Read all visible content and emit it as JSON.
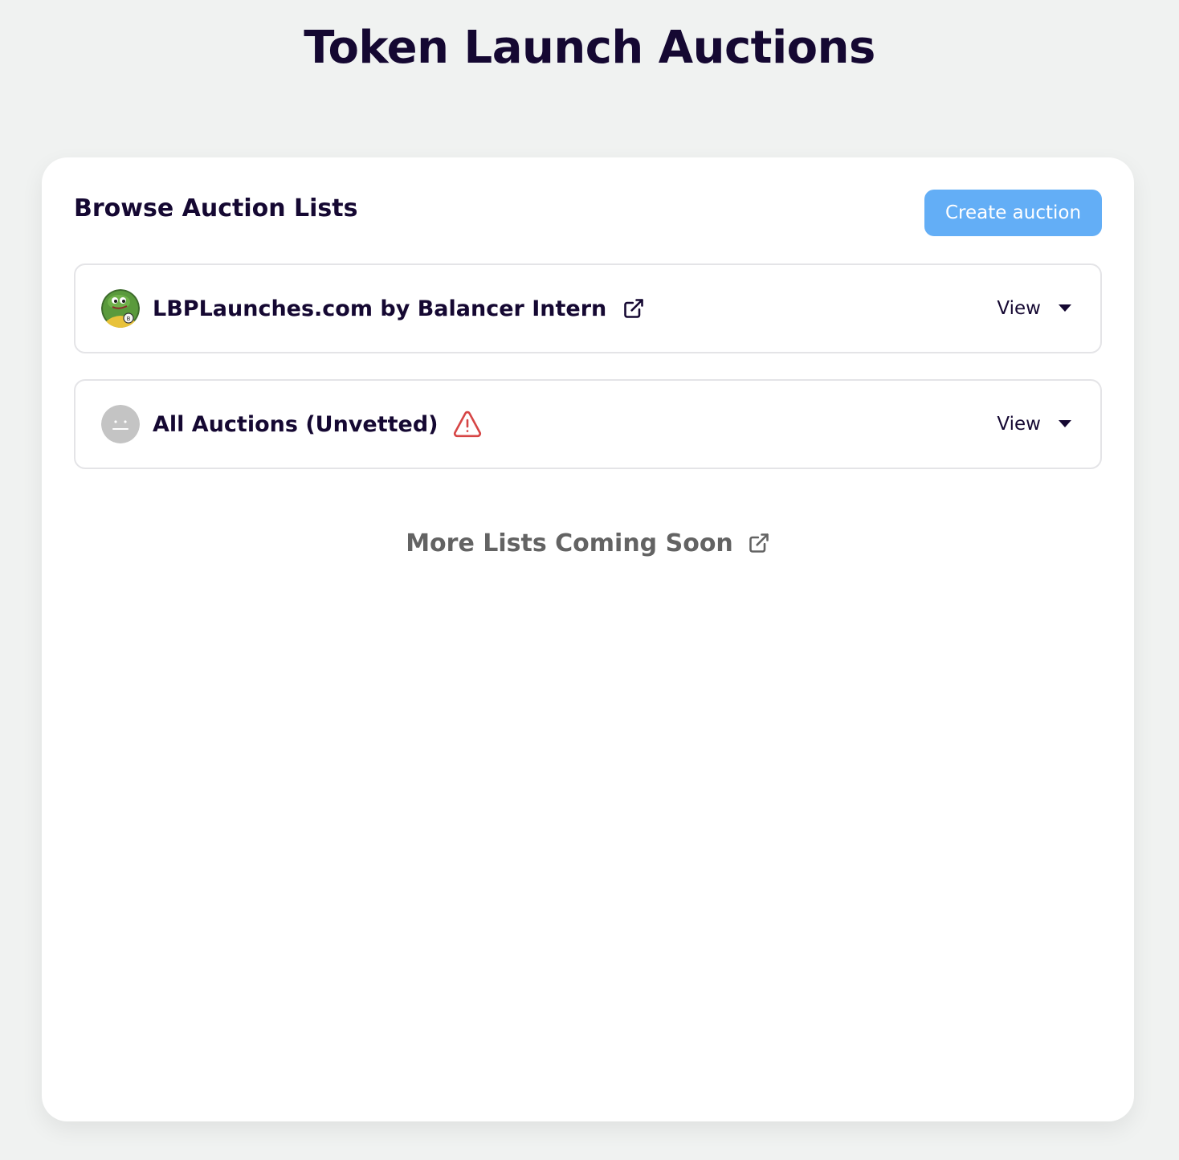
{
  "header": {
    "title": "Token Launch Auctions"
  },
  "main": {
    "section_title": "Browse Auction Lists",
    "create_button_label": "Create auction",
    "lists": [
      {
        "name": "LBPLaunches.com by Balancer Intern",
        "view_label": "View",
        "icon": "external-link-icon",
        "avatar": "frog-avatar"
      },
      {
        "name": "All Auctions (Unvetted)",
        "view_label": "View",
        "icon": "warning-icon",
        "avatar": "neutral-face-avatar"
      }
    ],
    "coming_soon_label": "More Lists Coming Soon"
  },
  "colors": {
    "background": "#f0f2f1",
    "card": "#ffffff",
    "text": "#150832",
    "accent_button": "#63aef6",
    "warning": "#d64545",
    "muted_text": "#636363"
  }
}
